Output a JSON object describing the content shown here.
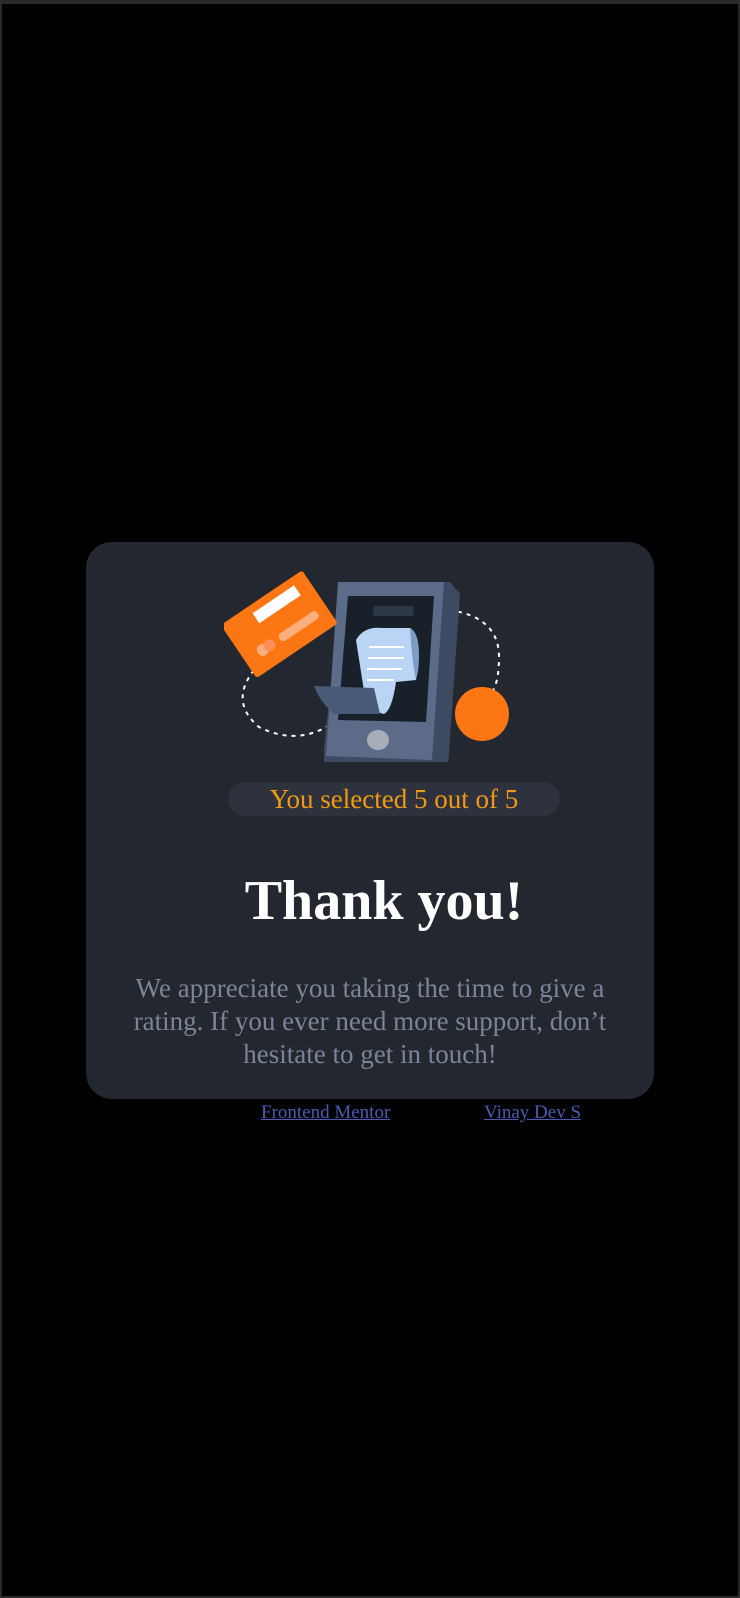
{
  "thank_you_card": {
    "rating_text": "You selected 5 out of 5",
    "title": "Thank you!",
    "message": "We appreciate you taking the time to give a rating. If you ever need more support, don’t hesitate to get in touch!",
    "accent_color": "#FC7614",
    "rating_color": "#F29A15",
    "card_background": "#232830"
  },
  "attribution": {
    "frontend_mentor_label": "Frontend Mentor",
    "author_label": "Vinay Dev S",
    "link_color": "#4A5BB5"
  },
  "icons": {
    "illustration": "phone-payment-illustration"
  },
  "page_background": "#000000"
}
